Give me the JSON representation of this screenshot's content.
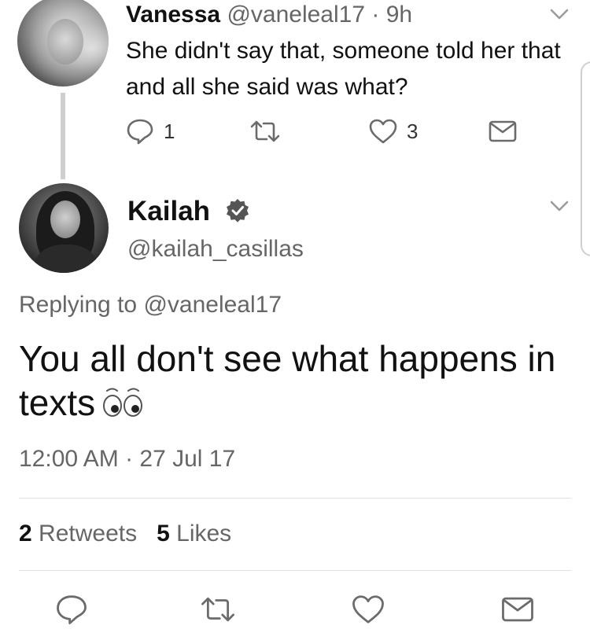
{
  "reply_tweet": {
    "name": "Vanessa",
    "handle": "@vaneleal17",
    "separator": "·",
    "time": "9h",
    "text": "She didn't say that, someone told her that and all she said was what?",
    "reply_count": "1",
    "like_count": "3"
  },
  "main_tweet": {
    "name": "Kailah",
    "handle": "@kailah_casillas",
    "replying_prefix": "Replying to",
    "replying_to": "@vaneleal17",
    "text": "You all don't see what happens in texts",
    "timestamp": "12:00 AM · 27 Jul 17",
    "retweet_count": "2",
    "retweets_label": "Retweets",
    "like_count": "5",
    "likes_label": "Likes"
  },
  "icons": {
    "reply": "reply-icon",
    "retweet": "retweet-icon",
    "like": "heart-icon",
    "dm": "envelope-icon",
    "verified": "verified-badge-icon",
    "more": "chevron-down-icon",
    "emoji": "eyes-emoji"
  },
  "colors": {
    "text_primary": "#111111",
    "text_secondary": "#666666",
    "icon_gray": "#6b6b6b",
    "verified": "#555555"
  }
}
